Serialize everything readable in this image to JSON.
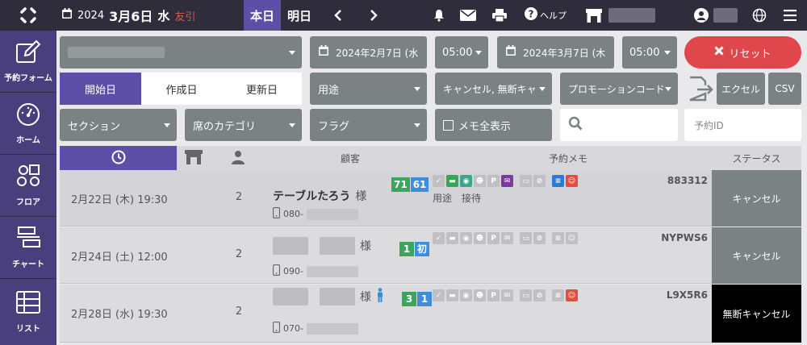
{
  "header": {
    "year": "2024",
    "month_day": "3月6日",
    "weekday": "水",
    "rokuyo": "友引",
    "today_label": "本日",
    "tomorrow_label": "明日",
    "help_label": "ヘルプ",
    "icons": [
      "app-logo-icon",
      "calendar-icon",
      "chevron-left-icon",
      "chevron-right-icon",
      "bell-icon",
      "mail-icon",
      "printer-icon",
      "question-icon",
      "store-icon",
      "user-icon",
      "globe-icon",
      "hamburger-icon"
    ]
  },
  "sidebar": {
    "items": [
      {
        "label": "予約フォーム",
        "icon": "edit-icon"
      },
      {
        "label": "ホーム",
        "icon": "dashboard-icon"
      },
      {
        "label": "フロア",
        "icon": "floor-icon"
      },
      {
        "label": "チャート",
        "icon": "chart-icon"
      },
      {
        "label": "リスト",
        "icon": "list-icon"
      }
    ]
  },
  "filters": {
    "date_from": "2024年2月7日 (水",
    "time_from": "05:00",
    "date_to": "2024年3月7日 (木",
    "time_to": "05:00",
    "reset_label": "リセット",
    "date_tabs": [
      "開始日",
      "作成日",
      "更新日"
    ],
    "purpose": "用途",
    "cancel_filter": "キャンセル, 無断キャ",
    "promo_code": "プロモーションコード",
    "excel_label": "エクセル",
    "csv_label": "CSV",
    "section": "セクション",
    "seat_category": "席のカテゴリ",
    "flag": "フラグ",
    "memo_toggle": "メモ全表示",
    "reservation_id_placeholder": "予約ID"
  },
  "table": {
    "headers": {
      "customer": "顧客",
      "memo": "予約メモ",
      "status": "ステータス"
    },
    "rows": [
      {
        "date": "2月22日 (木) 19:30",
        "people": "2",
        "name": "テーブルたろう",
        "honorific": "様",
        "phone_prefix": "080-",
        "visit_count": "71",
        "visit_count2": "61",
        "memo": "用途　接待",
        "code": "883312",
        "status": "キャンセル"
      },
      {
        "date": "2月24日 (土) 12:00",
        "people": "2",
        "name": "",
        "honorific": "様",
        "phone_prefix": "090-",
        "visit_count": "1",
        "visit_count2": "初",
        "memo": "",
        "code": "NYPWS6",
        "status": "キャンセル"
      },
      {
        "date": "2月28日 (水) 19:30",
        "people": "2",
        "name": "",
        "honorific": "様",
        "phone_prefix": "070-",
        "visit_count": "3",
        "visit_count2": "1",
        "memo": "",
        "code": "L9X5R6",
        "status": "無断キャンセル"
      }
    ]
  },
  "colors": {
    "topbar": "#2f2d3c",
    "accent_purple": "#5d4fa8",
    "reset_red": "#e0474c",
    "control_gray": "#7a8284",
    "status_black": "#000000"
  }
}
